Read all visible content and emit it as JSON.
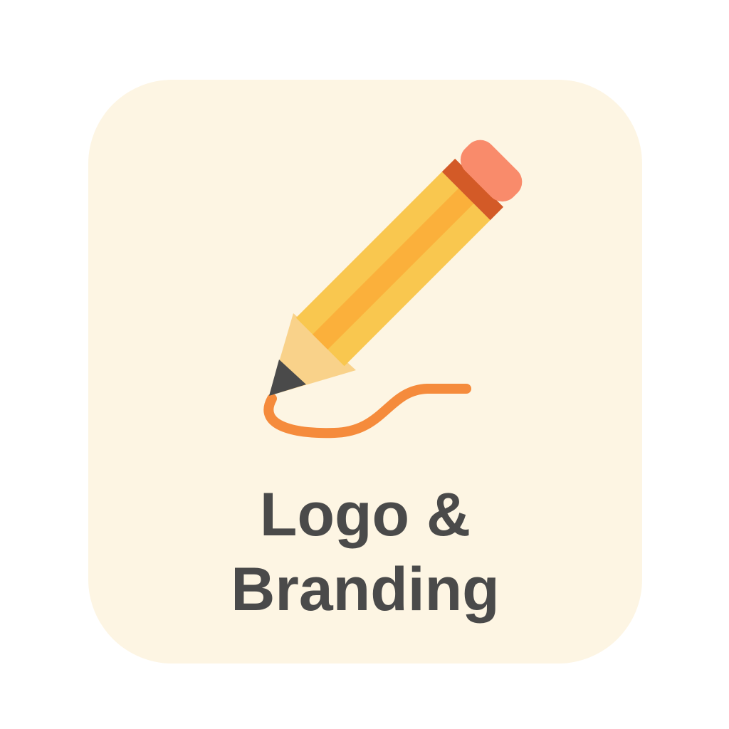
{
  "card": {
    "icon": "pencil-icon",
    "title_line1": "Logo &",
    "title_line2": "Branding",
    "colors": {
      "background": "#fdf5e3",
      "pencil_body": "#f9c74f",
      "pencil_stripe": "#fbb03b",
      "pencil_band": "#d35a27",
      "eraser": "#f98b6b",
      "wood": "#f9d28a",
      "lead": "#4a4a4a",
      "stroke": "#f58b3c",
      "text": "#4a4a4a"
    }
  }
}
